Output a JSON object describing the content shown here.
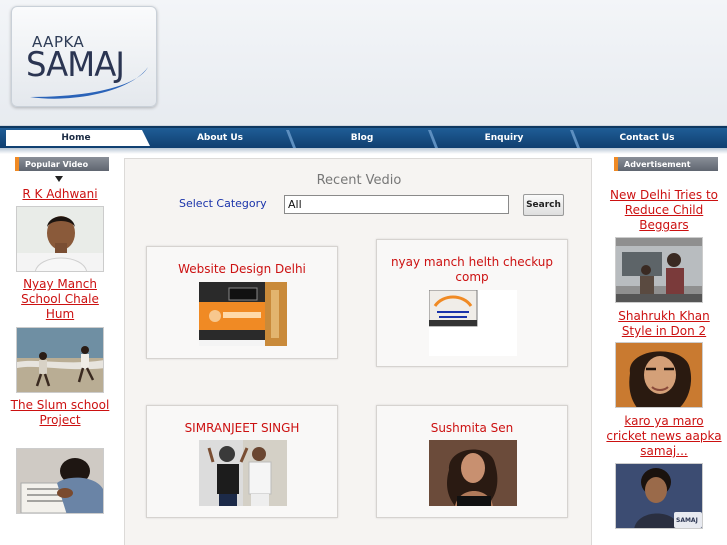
{
  "header": {
    "logo_top": "AAPKA",
    "logo_main": "SAMAJ"
  },
  "nav": {
    "items": [
      "Home",
      "About Us",
      "Blog",
      "Enquiry",
      "Contact Us"
    ],
    "active": "Home"
  },
  "left_sidebar": {
    "heading": "Popular Video",
    "items": [
      {
        "title": "R K Adhwani",
        "image": "man-portrait-photo"
      },
      {
        "title": "Nyay Manch School Chale Hum",
        "image": "children-running-beach-photo"
      },
      {
        "title": "The Slum school Project",
        "image": "child-writing-photo"
      }
    ]
  },
  "right_sidebar": {
    "heading": "Advertisement",
    "items": [
      {
        "title": "New Delhi Tries to Reduce Child Beggars",
        "image": "child-beggars-car-photo"
      },
      {
        "title": "Shahrukh Khan Style in Don 2",
        "image": "actor-portrait-photo"
      },
      {
        "title": "karo ya maro cricket news aapka samaj...",
        "image": "young-man-photo",
        "watermark": "SAMAJ"
      }
    ]
  },
  "main": {
    "title": "Recent Vedio",
    "category_label": "Select Category",
    "category_value": "All",
    "search_label": "Search",
    "videos": [
      {
        "title": "Website Design Delhi"
      },
      {
        "title": "nyay manch helth checkup comp"
      },
      {
        "title": "SIMRANJEET SINGH"
      },
      {
        "title": "Sushmita Sen"
      }
    ]
  },
  "colors": {
    "nav_bg": "#1a5189",
    "link_red": "#cc1111",
    "label_blue": "#1a33aa",
    "accent_orange": "#f08a24"
  }
}
